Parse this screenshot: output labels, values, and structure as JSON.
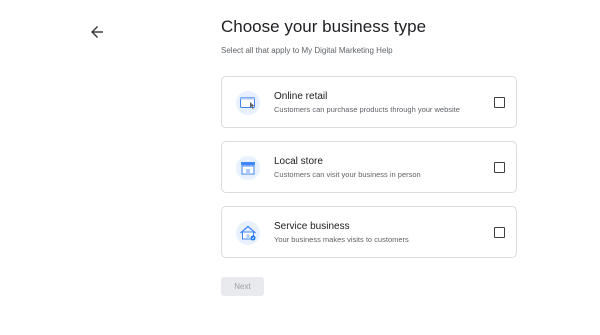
{
  "header": {
    "title": "Choose your business type",
    "subtitle": "Select all that apply to My Digital Marketing Help"
  },
  "options": [
    {
      "title": "Online retail",
      "description": "Customers can purchase products through your website",
      "icon": "online-retail-icon",
      "checked": false
    },
    {
      "title": "Local store",
      "description": "Customers can visit your business in person",
      "icon": "local-store-icon",
      "checked": false
    },
    {
      "title": "Service business",
      "description": "Your business makes visits to customers",
      "icon": "service-business-icon",
      "checked": false
    }
  ],
  "footer": {
    "next_label": "Next"
  },
  "colors": {
    "icon_bg": "#e8f0fe",
    "icon_accent": "#4285f4",
    "icon_dark": "#1a73e8",
    "disabled_button_bg": "#e8eaed"
  }
}
